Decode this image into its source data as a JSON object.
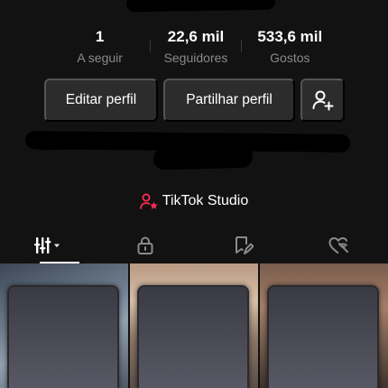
{
  "stats": [
    {
      "value": "1",
      "label": "A seguir"
    },
    {
      "value": "22,6 mil",
      "label": "Seguidores"
    },
    {
      "value": "533,6 mil",
      "label": "Gostos"
    }
  ],
  "actions": {
    "edit_profile": "Editar perfil",
    "share_profile": "Partilhar perfil"
  },
  "studio": {
    "label": "TikTok Studio",
    "accent": "#fe2c55"
  },
  "tabs": [
    {
      "icon": "videos-grid-icon",
      "active": true
    },
    {
      "icon": "lock-icon",
      "active": false
    },
    {
      "icon": "saved-icon",
      "active": false
    },
    {
      "icon": "liked-icon",
      "active": false
    }
  ],
  "colors": {
    "background": "#121212",
    "button": "#2c2c2c",
    "muted_text": "#8a8a8a"
  }
}
